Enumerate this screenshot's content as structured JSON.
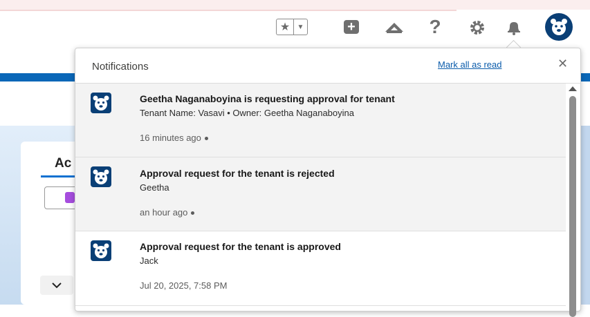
{
  "header": {
    "icons": [
      "star-icon",
      "chevron-down-icon",
      "plus-icon",
      "trailhead-icon",
      "help-icon",
      "gear-icon",
      "bell-icon",
      "avatar-bear-icon"
    ]
  },
  "background": {
    "card_title": "Ac"
  },
  "notifications": {
    "title": "Notifications",
    "mark_all": "Mark all as read",
    "close": "✕",
    "items": [
      {
        "title": "Geetha Naganaboyina is requesting approval for tenant",
        "body": "Tenant Name: Vasavi • Owner: Geetha Naganaboyina",
        "time": "16 minutes ago",
        "unread": true
      },
      {
        "title": "Approval request for the tenant is rejected",
        "body": "Geetha",
        "time": "an hour ago",
        "unread": true
      },
      {
        "title": "Approval request for the tenant is approved",
        "body": "Jack",
        "time": "Jul 20, 2025, 7:58 PM",
        "unread": false
      }
    ]
  },
  "colors": {
    "brand_dark": "#0a3f76",
    "link": "#0b5cab",
    "unread_bg": "#f3f3f3"
  }
}
